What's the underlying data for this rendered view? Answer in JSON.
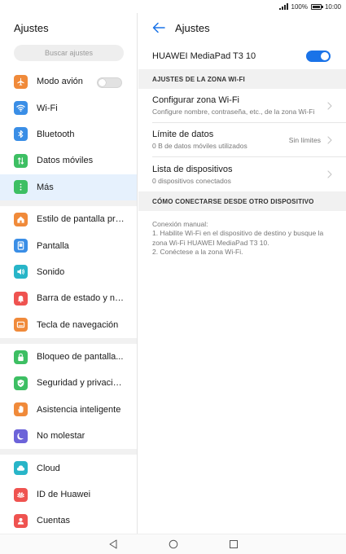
{
  "status_bar": {
    "battery_percent": "100%",
    "time": "10:00"
  },
  "left": {
    "title": "Ajustes",
    "search_placeholder": "Buscar ajustes",
    "groups": [
      [
        {
          "label": "Modo avión",
          "icon": "airplane-icon",
          "color": "#f08a3a",
          "toggle": false
        },
        {
          "label": "Wi-Fi",
          "icon": "wifi-icon",
          "color": "#3a8ee6"
        },
        {
          "label": "Bluetooth",
          "icon": "bluetooth-icon",
          "color": "#3a8ee6"
        },
        {
          "label": "Datos móviles",
          "icon": "mobile-data-icon",
          "color": "#3dbf63"
        },
        {
          "label": "Más",
          "icon": "more-icon",
          "color": "#3dbf63",
          "selected": true
        }
      ],
      [
        {
          "label": "Estilo de pantalla pri...",
          "icon": "home-screen-icon",
          "color": "#f08a3a"
        },
        {
          "label": "Pantalla",
          "icon": "display-icon",
          "color": "#3a8ee6"
        },
        {
          "label": "Sonido",
          "icon": "sound-icon",
          "color": "#28b5c8"
        },
        {
          "label": "Barra de estado y no...",
          "icon": "notification-icon",
          "color": "#ef5350"
        },
        {
          "label": "Tecla de navegación",
          "icon": "navigation-key-icon",
          "color": "#f08a3a"
        }
      ],
      [
        {
          "label": "Bloqueo de pantalla...",
          "icon": "lock-icon",
          "color": "#3dbf63"
        },
        {
          "label": "Seguridad y privacid...",
          "icon": "shield-icon",
          "color": "#3dbf63"
        },
        {
          "label": "Asistencia inteligente",
          "icon": "hand-icon",
          "color": "#f08a3a"
        },
        {
          "label": "No molestar",
          "icon": "moon-icon",
          "color": "#6c63d9"
        }
      ],
      [
        {
          "label": "Cloud",
          "icon": "cloud-icon",
          "color": "#28b5c8"
        },
        {
          "label": "ID de Huawei",
          "icon": "huawei-icon",
          "color": "#ef5350"
        },
        {
          "label": "Cuentas",
          "icon": "account-icon",
          "color": "#ef5350"
        }
      ]
    ]
  },
  "right": {
    "title": "Ajustes",
    "hotspot_name": "HUAWEI MediaPad T3 10",
    "hotspot_enabled": true,
    "section1": "AJUSTES DE LA ZONA WI-FI",
    "items": [
      {
        "title": "Configurar zona Wi-Fi",
        "subtitle": "Configure nombre, contraseña, etc., de la zona Wi-Fi",
        "value": ""
      },
      {
        "title": "Límite de datos",
        "subtitle": "0 B de datos móviles utilizados",
        "value": "Sin límites"
      },
      {
        "title": "Lista de dispositivos",
        "subtitle": "0 dispositivos conectados",
        "value": ""
      }
    ],
    "section2": "CÓMO CONECTARSE DESDE OTRO DISPOSITIVO",
    "manual_lines": [
      "Conexión manual:",
      "1. Habilite Wi-Fi en el dispositivo de destino y busque la zona Wi-Fi HUAWEI MediaPad T3 10.",
      "2. Conéctese a la zona Wi-Fi."
    ]
  },
  "colors": {
    "accent": "#1a73e8",
    "selected_bg": "#e6f1fd"
  }
}
